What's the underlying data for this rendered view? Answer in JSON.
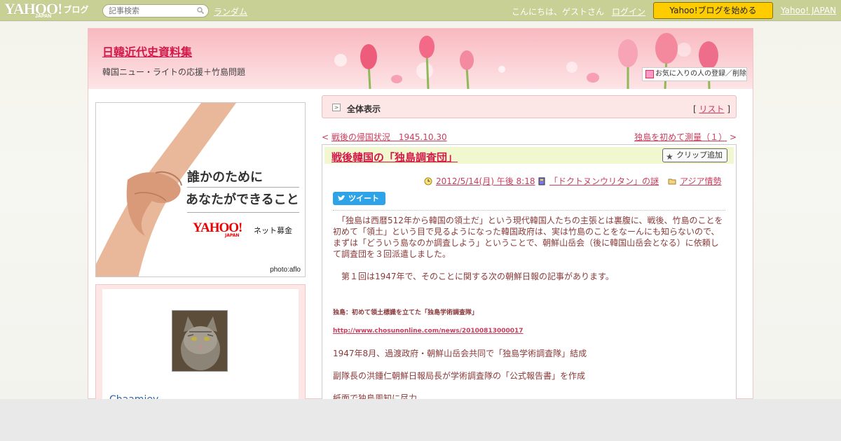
{
  "topbar": {
    "logo_text": "YAHOO!",
    "logo_japan": "JAPAN",
    "logo_blog": "ブログ",
    "search_placeholder": "記事検索",
    "random_link": "ランダム",
    "greeting": "こんにちは、ゲストさん",
    "login_link": "ログイン",
    "start_button": "Yahoo!ブログを始める",
    "yahoo_japan_link": "Yahoo! JAPAN"
  },
  "header": {
    "blog_title": "日韓近代史資料集",
    "blog_subtitle": "韓国ニュー・ライトの応援＋竹島問題",
    "favorite_button": "お気に入りの人の登録／削除"
  },
  "ad": {
    "line1": "誰かのために",
    "line2": "あなたができること",
    "logo_text": "YAHOO!",
    "logo_japan": "JAPAN",
    "service": "ネット募金",
    "photo_credit": "photo:aflo"
  },
  "profile": {
    "username": "Chaamiey"
  },
  "article_nav": {
    "all_label": "全体表示",
    "list_prefix": "[ ",
    "list_link": "リスト",
    "list_suffix": " ]",
    "prev_prefix": "< ",
    "prev_title": "戦後の帰国状況　1945.10.30",
    "next_title": "独島を初めて測量（１）",
    "next_suffix": " >"
  },
  "post": {
    "title": "戦後韓国の「独島調査団」",
    "clip_button": "クリップ追加",
    "date": "2012/5/14(月) 午後 8:18",
    "book": "「ドクトヌンウリタン」の謎",
    "category": "アジア情勢",
    "tweet_button": "ツイート",
    "para1": "　「独島は西暦512年から韓国の領土だ」という現代韓国人たちの主張とは裏腹に、戦後、竹島のことを初めて「領土」という目で見るようになった韓国政府は、実は竹島のことをなーんにも知らないので、まずは「どういう島なのか調査しよう」ということで、朝鮮山岳会（後に韓国山岳会となる）に依頼して調査団を３回派遣しました。",
    "para2": "　第１回は1947年で、そのことに関する次の朝鮮日報の記事があります。",
    "quote_title": "独島：初めて領土標識を立てた「独島学術調査隊」",
    "quote_url": "http://www.chosunonline.com/news/20100813000017",
    "line1": "1947年8月、過渡政府・朝鮮山岳会共同で「独島学術調査隊」結成",
    "line2": "副隊長の洪鍾仁朝鮮日報局長が学術調査隊の「公式報告書」を作成",
    "line3": "紙面で独島周知に尽力"
  },
  "colors": {
    "topbar": "#c9d095",
    "accent_red": "#d5184a",
    "link_pink": "#c83c5c",
    "header_pink": "#f8b9c0",
    "start_button": "#ffcc00",
    "tweet_blue": "#2ea3e8"
  },
  "icons": {
    "search": "magnifier-icon",
    "favorite": "heart-icon",
    "clip": "star-icon",
    "date": "clock-icon",
    "book": "book-icon",
    "category": "folder-icon",
    "tweet": "bird-icon"
  }
}
